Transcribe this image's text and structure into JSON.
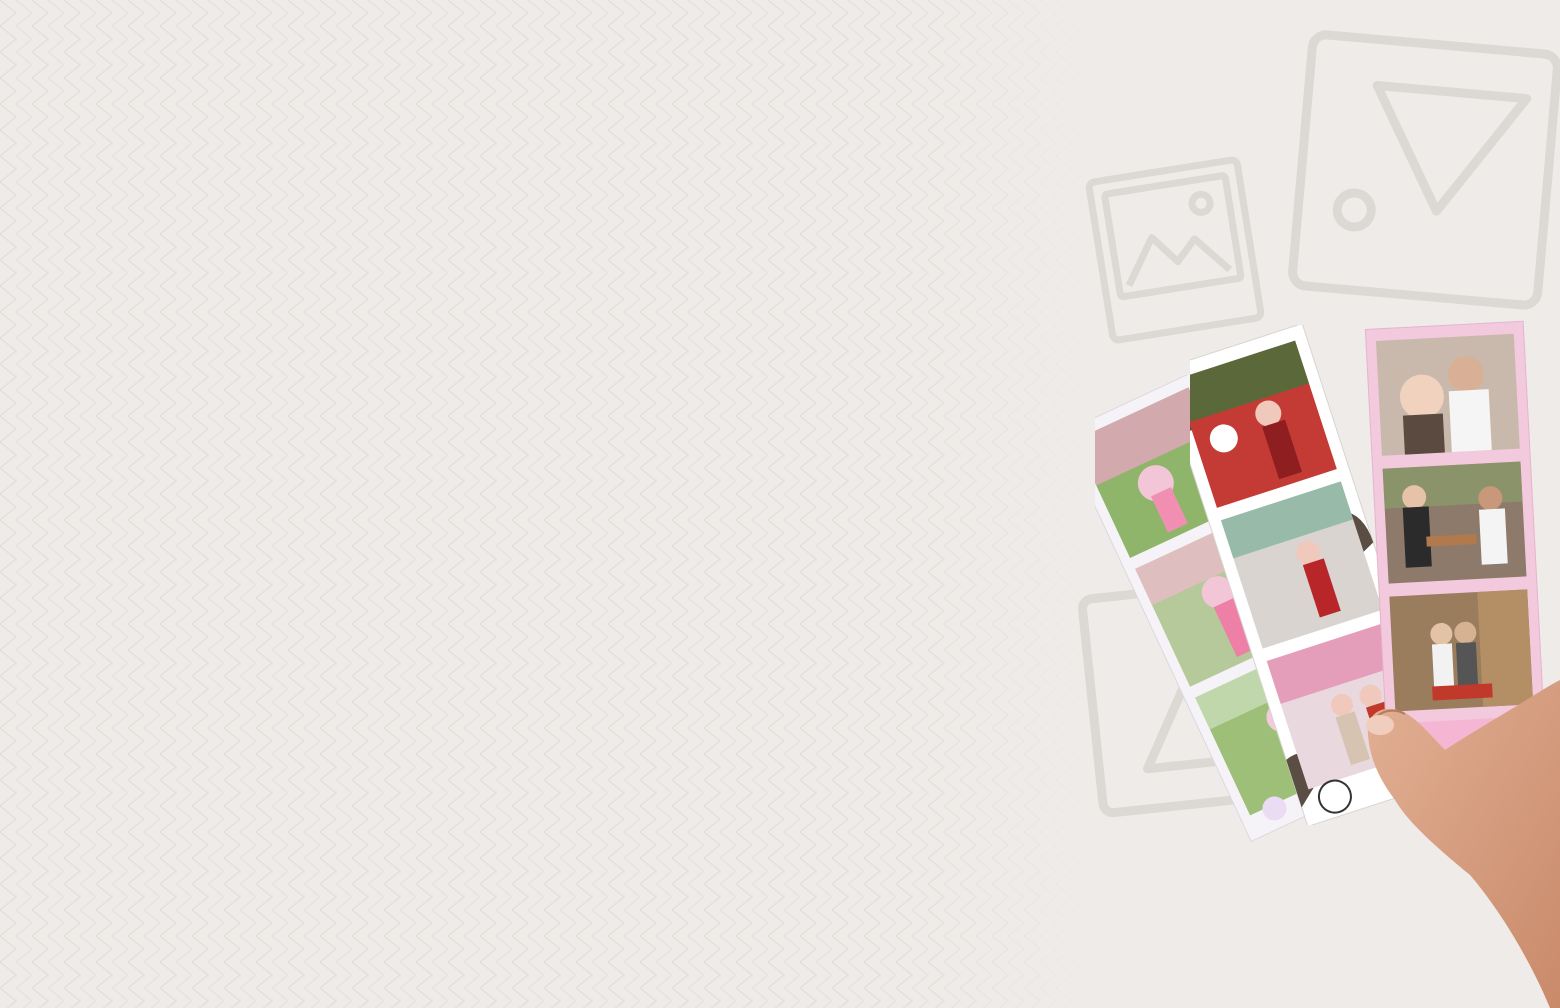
{
  "scene": {
    "description_tag": "photo-booth-strips-held-in-hand",
    "background_color": "#efebe8",
    "pattern_color": "#e3dfdb",
    "outline_icon_color": "#dcd8d4"
  },
  "strips": [
    {
      "name": "strip-garden",
      "border_color": "#f5f3f7",
      "frame_colors": [
        "#8fb56a",
        "#b6c99a",
        "#9dbf78"
      ]
    },
    {
      "name": "strip-cow",
      "border_color": "#ffffff",
      "frame_colors": [
        "#c43a34",
        "#d9d4cf",
        "#e9d8dd"
      ]
    },
    {
      "name": "strip-pink",
      "border_color": "#f2c9dd",
      "frame_colors": [
        "#c9b9ad",
        "#8d7a6a",
        "#9a7d5d"
      ]
    }
  ],
  "icons": [
    "image-frame-icon",
    "play-triangle-icon",
    "triangle-outline-icon"
  ]
}
